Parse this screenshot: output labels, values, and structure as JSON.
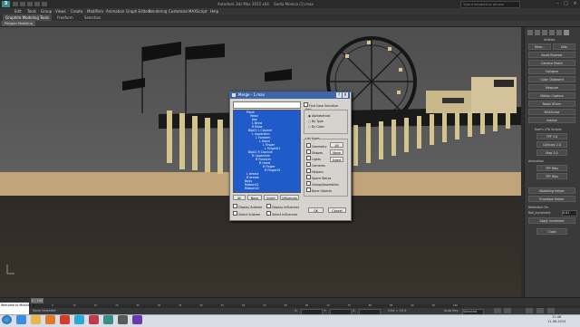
{
  "titlebar": {
    "app_title": "Autodesk 3ds Max  2015 x64",
    "doc_title": "Santa Monica (1).max",
    "search_placeholder": "Type a keyword or phrase",
    "logo": "3"
  },
  "menus": [
    "Edit",
    "Tools",
    "Group",
    "Views",
    "Create",
    "Modifiers",
    "Animation",
    "Graph Editors",
    "Rendering",
    "Customize",
    "MAXScript",
    "Help"
  ],
  "ribbon": {
    "tabs": [
      "Graphite Modeling Tools",
      "Freeform",
      "Selection"
    ],
    "sub": "Polygon Modeling"
  },
  "viewport": {
    "label": ""
  },
  "command_panel": {
    "header": "Utilities",
    "top_buttons": [
      "More...",
      "Sets"
    ],
    "buttons": [
      "Asset Browser",
      "Camera Match",
      "Collapse",
      "Color Clipboard",
      "Measure",
      "Motion Capture",
      "Reset XForm",
      "MAXScript",
      "reactor"
    ],
    "section2": "Kuei's UTA Scripts",
    "buttons2": [
      "TPF 3.0",
      "Collision 2.0",
      "Map 2.0"
    ],
    "section3": "Animation",
    "buttons3": [
      "TPF Ribs",
      "TPF Ribs"
    ],
    "buttons4": [
      "Modelling Helper",
      "Envelope Helper"
    ],
    "reflection_label": "Reflection Fix",
    "rollout_label": "Roll_increment",
    "rollout_value": "0.01",
    "apply_button": "Apply increment",
    "close_button": "Close"
  },
  "dialog": {
    "title": "Merge - 1.max",
    "help": "?",
    "close": "X",
    "tree": [
      "Plank",
      "Head",
      "Jaw",
      "L Brow",
      "R Brow",
      "Bip01 L Clavicle",
      "L UpperArm",
      "L Forearm",
      "L Hand",
      "L Finger",
      "L Finger01",
      "Bip01 R Clavicle",
      "R UpperArm",
      "R Forearm",
      "R Hand",
      "R Finger",
      "R Finger01",
      "L breast",
      "R breast",
      "Body",
      "Ribbon01",
      "Ribbon02"
    ],
    "find_case": "Find Case Sensitive",
    "sort_label": "Sort",
    "sort_options": [
      "Alphabetical",
      "By Type",
      "By Color"
    ],
    "list_types_label": "List types",
    "types": [
      "Geometry",
      "Shapes",
      "Lights",
      "Cameras",
      "Helpers",
      "Space Warps",
      "Group/Assemblies",
      "Bone Objects"
    ],
    "type_buttons": [
      "All",
      "None",
      "Invert"
    ],
    "list_buttons": [
      "All",
      "None",
      "Invert",
      "Influences"
    ],
    "options": [
      "Display Subtree",
      "Display Influences",
      "Select Subtree",
      "Select Influences"
    ],
    "ok": "OK",
    "cancel": "Cancel"
  },
  "timeline": {
    "frame": "0 / 100",
    "ticks": [
      "0",
      "5",
      "10",
      "15",
      "20",
      "25",
      "30",
      "35",
      "40",
      "45",
      "50",
      "55",
      "60",
      "65",
      "70",
      "75",
      "80",
      "85",
      "90",
      "95",
      "100"
    ]
  },
  "status": {
    "prompt": "Welcome to MAXScript",
    "selected": "None Selected",
    "hint": "Rendering Time  0:00:00",
    "x_label": "X:",
    "y_label": "Y:",
    "z_label": "Z:",
    "grid": "Grid = 10,0",
    "autokey": "Auto Key",
    "selected_dd": "Selected",
    "setkey": "Set Key",
    "keyfilters": "Key Filters...",
    "addtime": "Add Time Tag"
  },
  "taskbar": {
    "time": "11:48",
    "date": "11-06-2015"
  }
}
